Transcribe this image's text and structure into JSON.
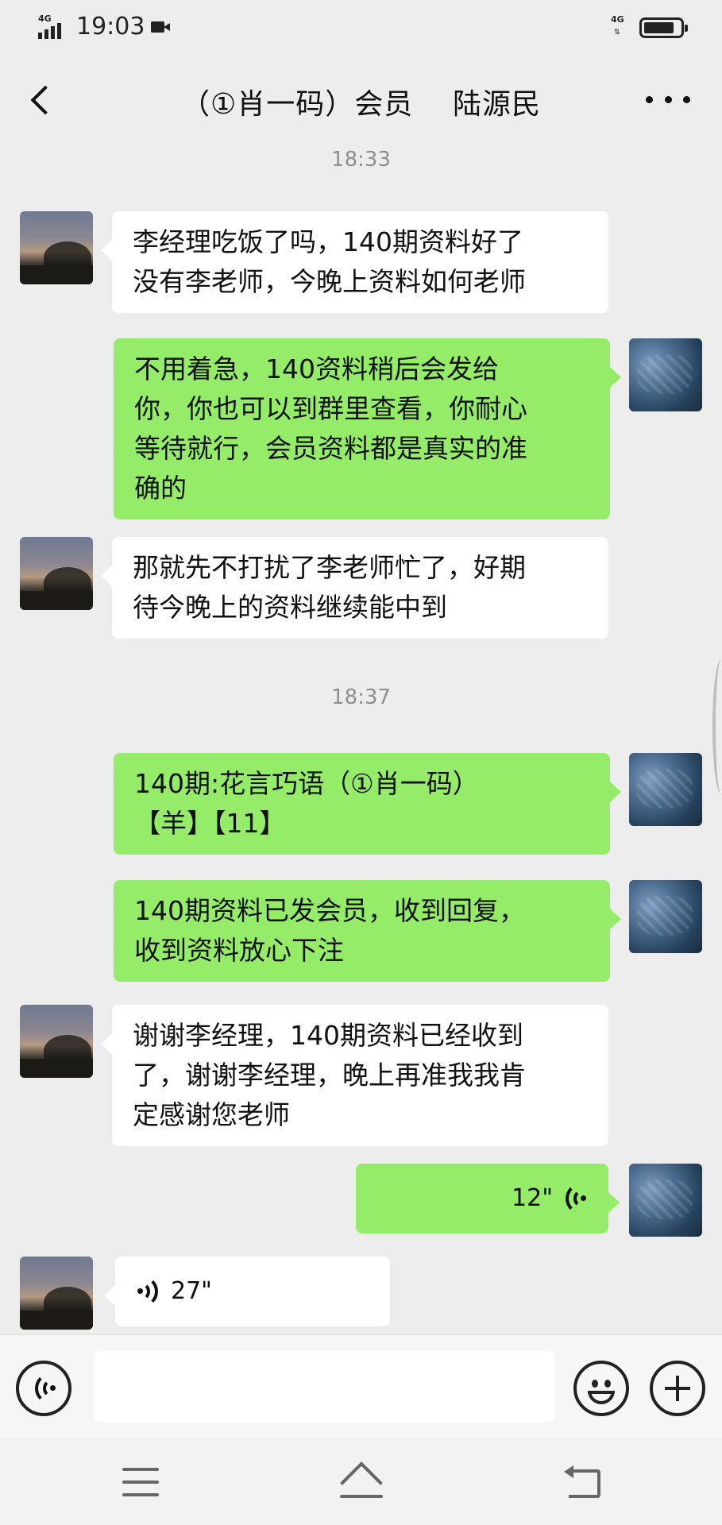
{
  "status_bar": {
    "network_left": "4G",
    "time": "19:03",
    "network_right": "4G",
    "battery_level": 0.85
  },
  "header": {
    "title": "（①肖一码）会员    陆源民"
  },
  "messages": [
    {
      "type": "time",
      "text": "18:33"
    },
    {
      "type": "text",
      "side": "left",
      "lines": [
        "李经理吃饭了吗，140期资料好了",
        "没有李老师，今晚上资料如何老师"
      ]
    },
    {
      "type": "text",
      "side": "right",
      "lines": [
        "不用着急，140资料稍后会发给",
        "你，你也可以到群里查看，你耐心",
        "等待就行，会员资料都是真实的准",
        "确的"
      ]
    },
    {
      "type": "text",
      "side": "left",
      "lines": [
        "那就先不打扰了李老师忙了，好期",
        "待今晚上的资料继续能中到"
      ]
    },
    {
      "type": "time",
      "text": "18:37"
    },
    {
      "type": "text",
      "side": "right",
      "lines": [
        "140期:花言巧语（①肖一码）",
        "【羊】【11】"
      ]
    },
    {
      "type": "text",
      "side": "right",
      "lines": [
        "140期资料已发会员，收到回复，",
        "收到资料放心下注"
      ]
    },
    {
      "type": "text",
      "side": "left",
      "lines": [
        "谢谢李经理，140期资料已经收到",
        "了，谢谢李经理，晚上再准我我肯",
        "定感谢您老师"
      ]
    },
    {
      "type": "voice",
      "side": "right",
      "duration": "12\""
    },
    {
      "type": "voice",
      "side": "left",
      "duration": "27\""
    }
  ],
  "input_bar": {
    "text_value": ""
  }
}
